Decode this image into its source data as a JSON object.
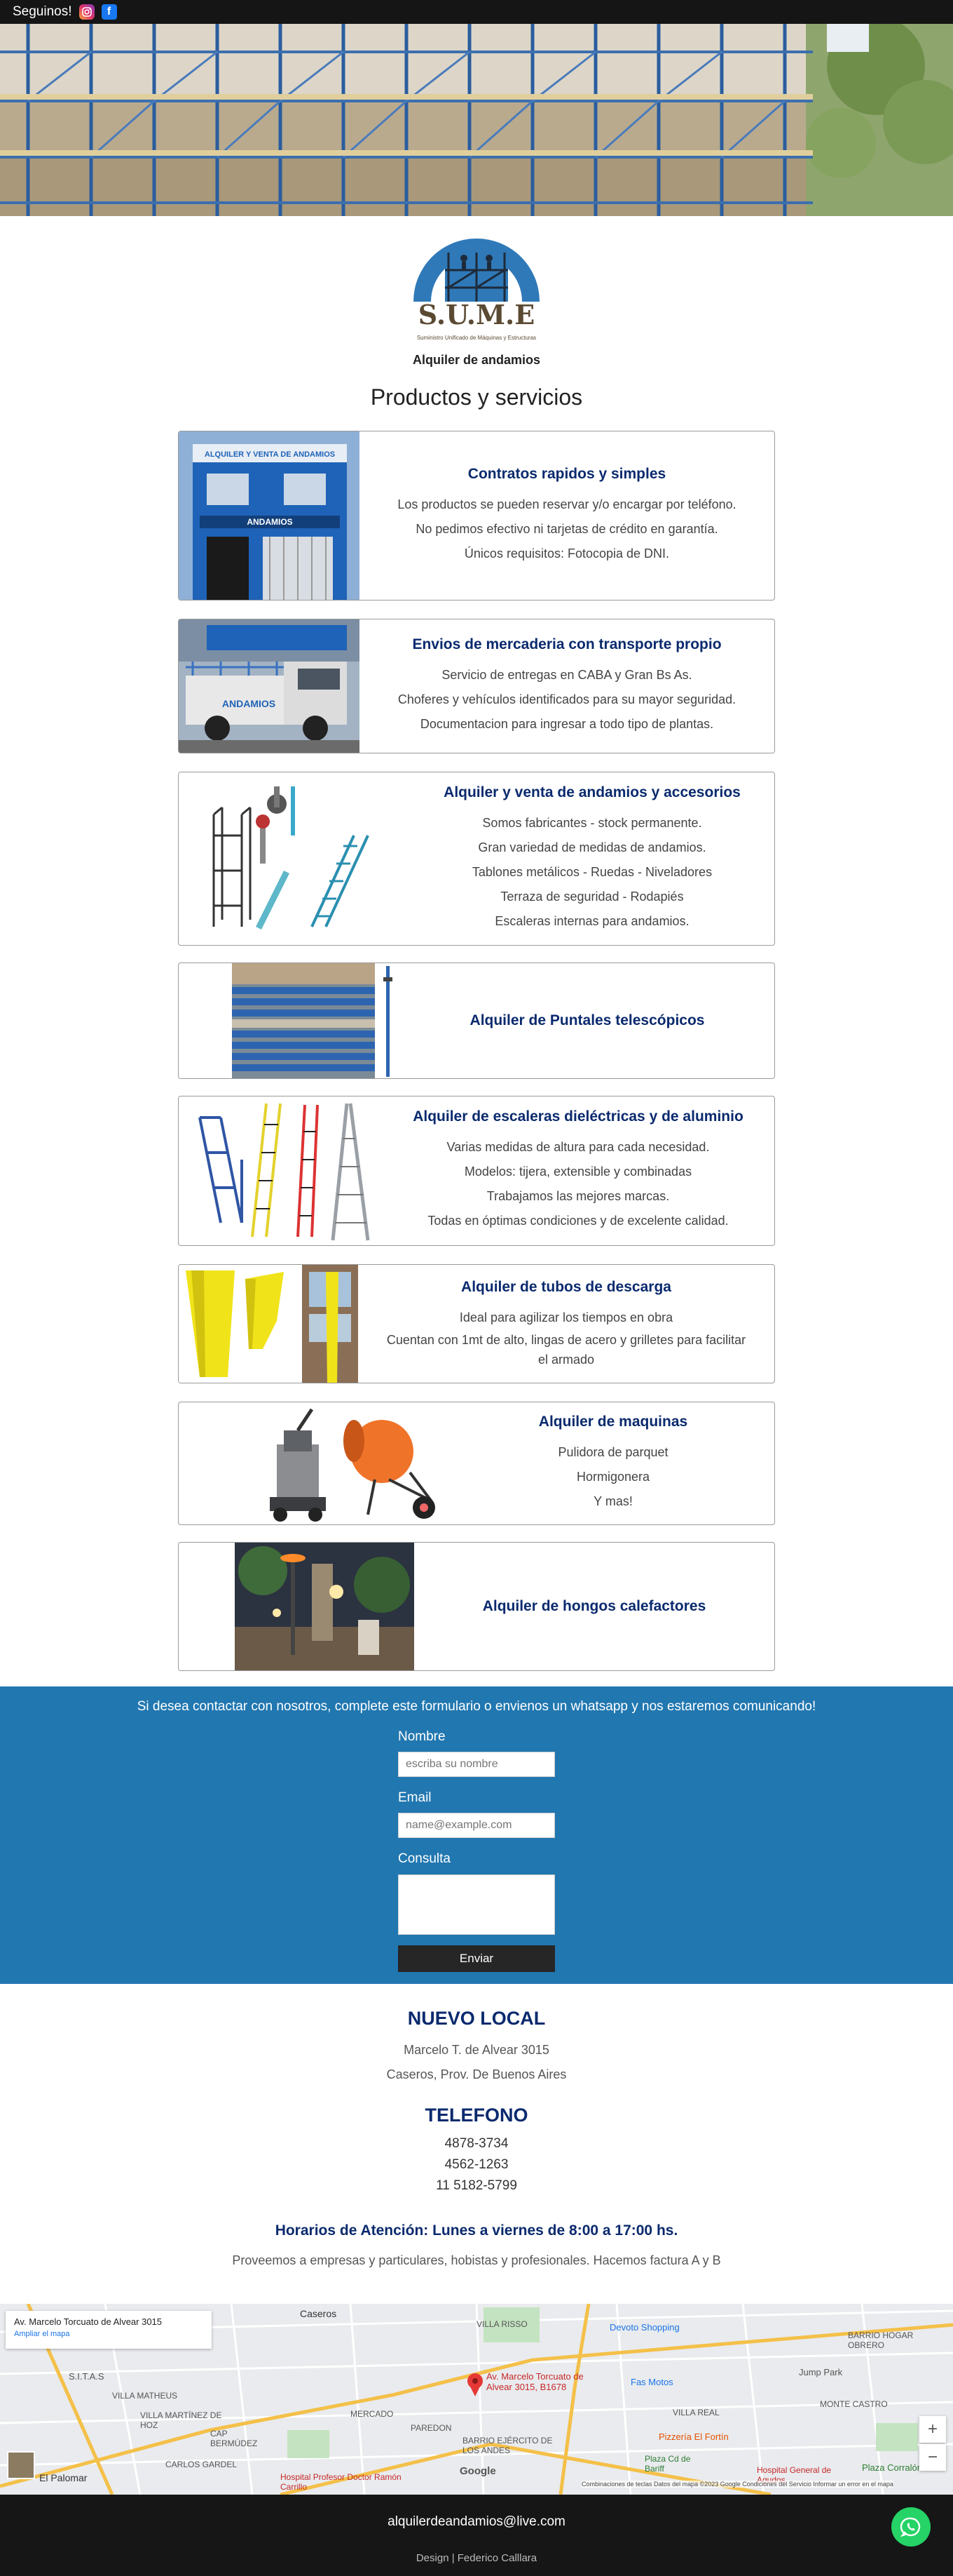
{
  "topbar": {
    "follow_label": "Seguinos!",
    "instagram_icon": "instagram-icon",
    "facebook_icon": "facebook-icon"
  },
  "brand": {
    "logo_text": "S.U.M.E",
    "logo_subtext": "Suministro Unificado de Máquinas y Estructuras",
    "tagline": "Alquiler de andamios"
  },
  "section_title": "Productos y servicios",
  "services": [
    {
      "title": "Contratos rapidos y simples",
      "lines": [
        "Los productos se pueden reservar y/o encargar por teléfono.",
        "No pedimos efectivo ni tarjetas de crédito en garantía.",
        "Únicos requisitos: Fotocopia de DNI."
      ],
      "image_sign": "ANDAMIOS"
    },
    {
      "title": "Envios de mercaderia con transporte propio",
      "lines": [
        "Servicio de entregas en CABA y Gran Bs As.",
        "Choferes y vehículos identificados para su mayor seguridad.",
        "Documentacion para ingresar a todo tipo de plantas."
      ],
      "image_sign": "ANDAMIOS"
    },
    {
      "title": "Alquiler y venta de andamios y accesorios",
      "lines": [
        "Somos fabricantes - stock permanente.",
        "Gran variedad de medidas de andamios.",
        "Tablones metálicos - Ruedas - Niveladores",
        "Terraza de seguridad - Rodapiés",
        "Escaleras internas para andamios."
      ]
    },
    {
      "title": "Alquiler de Puntales telescópicos",
      "lines": []
    },
    {
      "title": "Alquiler de escaleras dieléctricas y de aluminio",
      "lines": [
        "Varias medidas de altura para cada necesidad.",
        "Modelos: tijera, extensible y combinadas",
        "Trabajamos las mejores marcas.",
        "Todas en óptimas condiciones y de excelente calidad."
      ]
    },
    {
      "title": "Alquiler de tubos de descarga",
      "lines": [
        "Ideal para agilizar los tiempos en obra",
        "Cuentan con 1mt de alto, lingas de acero y grilletes para facilitar el armado"
      ]
    },
    {
      "title": "Alquiler de maquinas",
      "lines": [
        "Pulidora de parquet",
        "Hormigonera",
        "Y mas!"
      ]
    },
    {
      "title": "Alquiler de hongos calefactores",
      "lines": []
    }
  ],
  "contact": {
    "intro": "Si desea contactar con nosotros, complete este formulario o envienos un whatsapp y nos estaremos comunicando!",
    "name_label": "Nombre",
    "name_placeholder": "escriba su nombre",
    "email_label": "Email",
    "email_placeholder": "name@example.com",
    "message_label": "Consulta",
    "submit_label": "Enviar"
  },
  "location": {
    "heading": "NUEVO LOCAL",
    "address1": "Marcelo T. de Alvear 3015",
    "address2": "Caseros, Prov. De Buenos Aires"
  },
  "phones": {
    "heading": "TELEFONO",
    "numbers": [
      "4878-3734",
      "4562-1263",
      "11 5182-5799"
    ]
  },
  "hours": "Horarios de Atención: Lunes a viernes de 8:00 a 17:00 hs.",
  "providers": "Proveemos a empresas y particulares, hobistas y profesionales. Hacemos factura A y B",
  "map": {
    "place_title": "Av. Marcelo Torcuato de Alvear 3015",
    "enlarge_link": "Ampliar el mapa",
    "pin_label": "Av. Marcelo Torcuato de Alvear 3015, B1678",
    "labels": [
      "Caseros",
      "VILLA RISSO",
      "Devoto Shopping",
      "BARRIO HOGAR OBRERO",
      "S.I.T.A.S",
      "VILLA MATHEUS",
      "VILLA MARTÍNEZ DE HOZ",
      "CAP BERMÚDEZ",
      "CARLOS GARDEL",
      "MERCADO",
      "PAREDON",
      "BARRIO EJÉRCITO DE LOS ANDES",
      "Fas Motos",
      "Jump Park",
      "VILLA REAL",
      "Pizzería El Fortín",
      "Plaza Cd de Bariff",
      "Hospital General de Agudos",
      "Plaza Corralón",
      "El Palomar",
      "Hospital Profesor Doctor Ramón Carrillo",
      "MONTE CASTRO",
      "Google"
    ],
    "attribution": "Combinaciones de teclas   Datos del mapa ©2023 Google   Condiciones del Servicio   Informar un error en el mapa",
    "zoom_in": "+",
    "zoom_out": "−"
  },
  "footer": {
    "email": "alquilerdeandamios@live.com",
    "credit": "Design | Federico Calllara"
  },
  "colors": {
    "accent_blue": "#2177b0",
    "title_navy": "#0a2a6e",
    "dark": "#151515",
    "whatsapp": "#25d366"
  }
}
